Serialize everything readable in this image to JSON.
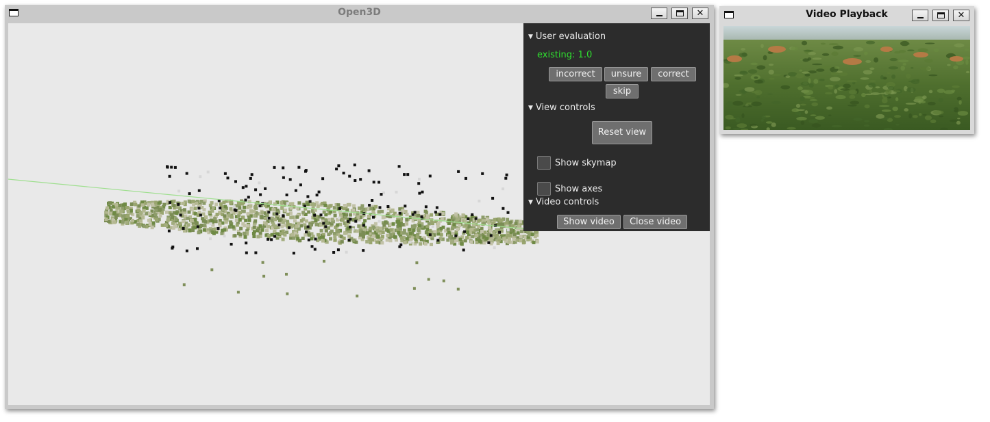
{
  "open3d": {
    "title": "Open3D",
    "panel": {
      "user_evaluation": {
        "header": "User evaluation",
        "existing": "existing: 1.0",
        "buttons": [
          "incorrect",
          "unsure",
          "correct",
          "skip"
        ]
      },
      "view_controls": {
        "header": "View controls",
        "reset_view": "Reset view",
        "show_skymap": "Show skymap",
        "show_axes": "Show axes"
      },
      "video_controls": {
        "header": "Video controls",
        "show_video": "Show video",
        "close_video": "Close video"
      }
    }
  },
  "video_playback": {
    "title": "Video Playback"
  },
  "colors": {
    "panel_bg": "#2c2c2c",
    "existing_text": "#2fe02f",
    "viewport_bg": "#e9e9e9",
    "titlebar_bg": "#c9c9c9"
  },
  "icons": [
    "window-menu-icon",
    "minimize-icon",
    "maximize-icon",
    "close-icon",
    "triangle-down-icon"
  ]
}
